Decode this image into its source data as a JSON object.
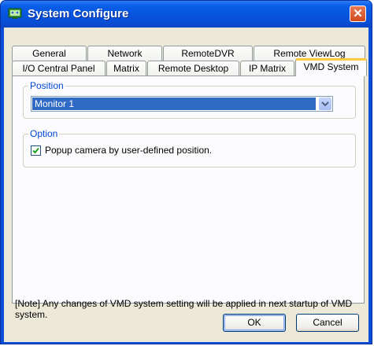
{
  "window": {
    "title": "System Configure"
  },
  "tabs": {
    "row1": [
      "General",
      "Network",
      "RemoteDVR",
      "Remote ViewLog"
    ],
    "row2": [
      "I/O Central Panel",
      "Matrix",
      "Remote Desktop",
      "IP Matrix",
      "VMD System"
    ],
    "active": "VMD System"
  },
  "position": {
    "legend": "Position",
    "selected": "Monitor 1"
  },
  "option": {
    "legend": "Option",
    "checkbox_label": "Popup camera by user-defined position.",
    "checked": true
  },
  "note": "[Note] Any changes of VMD system setting will be applied in next startup of VMD system.",
  "buttons": {
    "ok": "OK",
    "cancel": "Cancel"
  },
  "colors": {
    "title_bar": "#0754de",
    "legend_text": "#0046d5",
    "selection": "#316ac5",
    "active_tab_accent": "#ffc83d"
  }
}
